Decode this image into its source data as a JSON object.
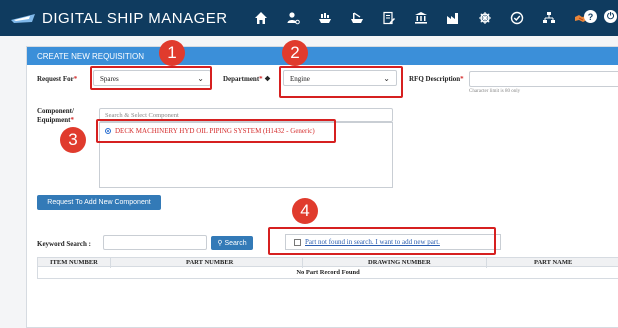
{
  "app": {
    "title": "DIGITAL SHIP MANAGER"
  },
  "nav": {
    "icons": [
      "home-icon",
      "user-settings-icon",
      "ship-icon",
      "crane-ship-icon",
      "document-edit-icon",
      "bank-icon",
      "factory-icon",
      "ship-wheel-icon",
      "badge-check-icon",
      "org-chart-icon",
      "handshake-icon"
    ],
    "right": {
      "help": "?",
      "power": "⏻"
    }
  },
  "panel": {
    "header": "CREATE NEW REQUISITION"
  },
  "form": {
    "request_for": {
      "label": "Request For",
      "value": "Spares"
    },
    "department": {
      "label": "Department",
      "value": "Engine"
    },
    "rfq": {
      "label": "RFQ Description",
      "hint": "Character limit is 80 only"
    },
    "component": {
      "label_line1": "Component/",
      "label_line2": "Equipment",
      "placeholder": "Search & Select Component",
      "selected": "DECK MACHINERY HYD OIL PIPING SYSTEM (H1432 - Generic)"
    },
    "add_component_button": "Request To Add New Component",
    "keyword": {
      "label": "Keyword Search :",
      "value": ""
    },
    "search_button": "Search",
    "part_not_found": "Part not found in search. I want to add new part."
  },
  "table": {
    "columns": [
      "ITEM NUMBER",
      "PART NUMBER",
      "DRAWING NUMBER",
      "PART NAME"
    ],
    "empty_message": "No Part Record Found"
  },
  "annotations": [
    "1",
    "2",
    "3",
    "4"
  ],
  "colors": {
    "navbar": "#0f3b5f",
    "panel_header": "#3b8fd9",
    "annotation": "#d62020",
    "button": "#337ab7"
  }
}
